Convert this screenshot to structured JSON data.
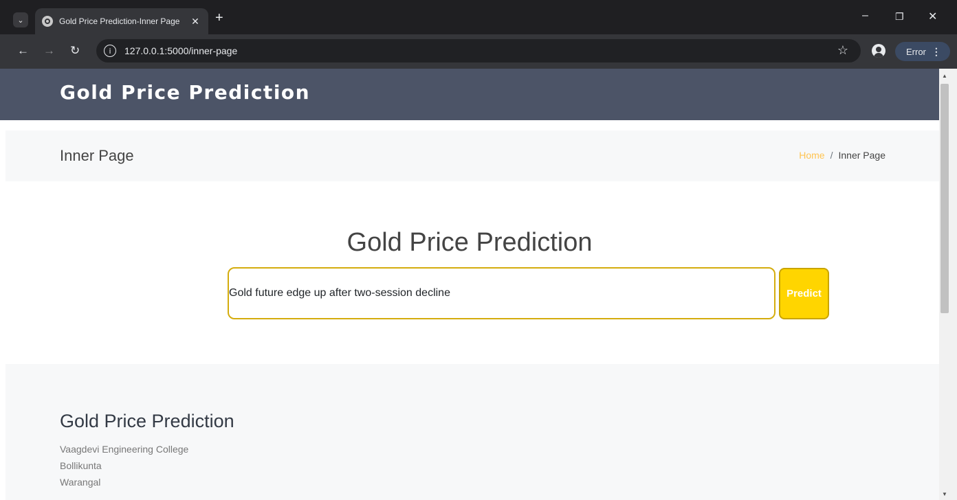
{
  "browser": {
    "tab_title": "Gold Price Prediction-Inner Page",
    "url": "127.0.0.1:5000/inner-page",
    "error_label": "Error"
  },
  "header": {
    "logo": "Gold Price Prediction"
  },
  "breadcrumbs": {
    "title": "Inner Page",
    "home_link": "Home",
    "separator": "/",
    "current": "Inner Page"
  },
  "main": {
    "heading": "Gold Price Prediction",
    "input_value": "Gold future edge up after two-session decline",
    "predict_label": "Predict"
  },
  "footer": {
    "title": "Gold Price Prediction",
    "lines": [
      "Vaagdevi Engineering College",
      "Bollikunta",
      "Warangal"
    ]
  },
  "colors": {
    "header_bg": "#4c5467",
    "accent": "#ffc451",
    "button": "#ffd500"
  }
}
